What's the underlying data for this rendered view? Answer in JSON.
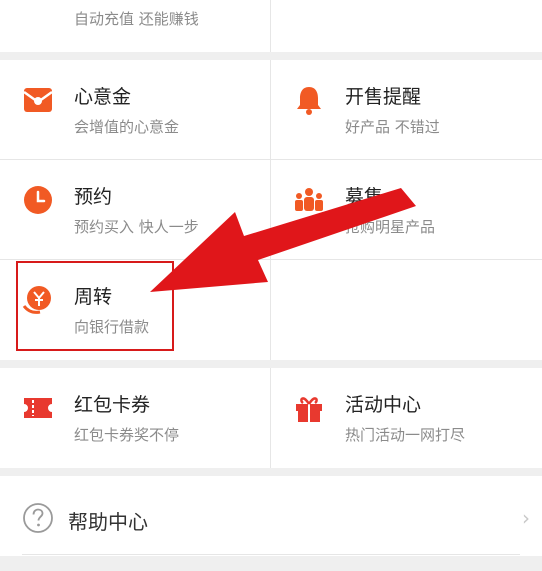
{
  "top": {
    "left_sub": "自动充值 还能赚钱"
  },
  "grid1": [
    {
      "title": "心意金",
      "sub": "会增值的心意金",
      "icon": "red-envelope-icon"
    },
    {
      "title": "开售提醒",
      "sub": "好产品 不错过",
      "icon": "bell-icon"
    },
    {
      "title": "预约",
      "sub": "预约买入 快人一步",
      "icon": "clock-icon"
    },
    {
      "title": "募集",
      "sub": "抢购明星产品",
      "icon": "people-icon"
    },
    {
      "title": "周转",
      "sub": "向银行借款",
      "icon": "yuan-hand-icon"
    }
  ],
  "grid2": [
    {
      "title": "红包卡券",
      "sub": "红包卡券奖不停",
      "icon": "ticket-icon"
    },
    {
      "title": "活动中心",
      "sub": "热门活动一网打尽",
      "icon": "gift-icon"
    }
  ],
  "help": {
    "label": "帮助中心",
    "icon": "question-circle-icon",
    "chevron": "›"
  },
  "colors": {
    "accent": "#f15a24",
    "annotation": "#e0161a"
  }
}
